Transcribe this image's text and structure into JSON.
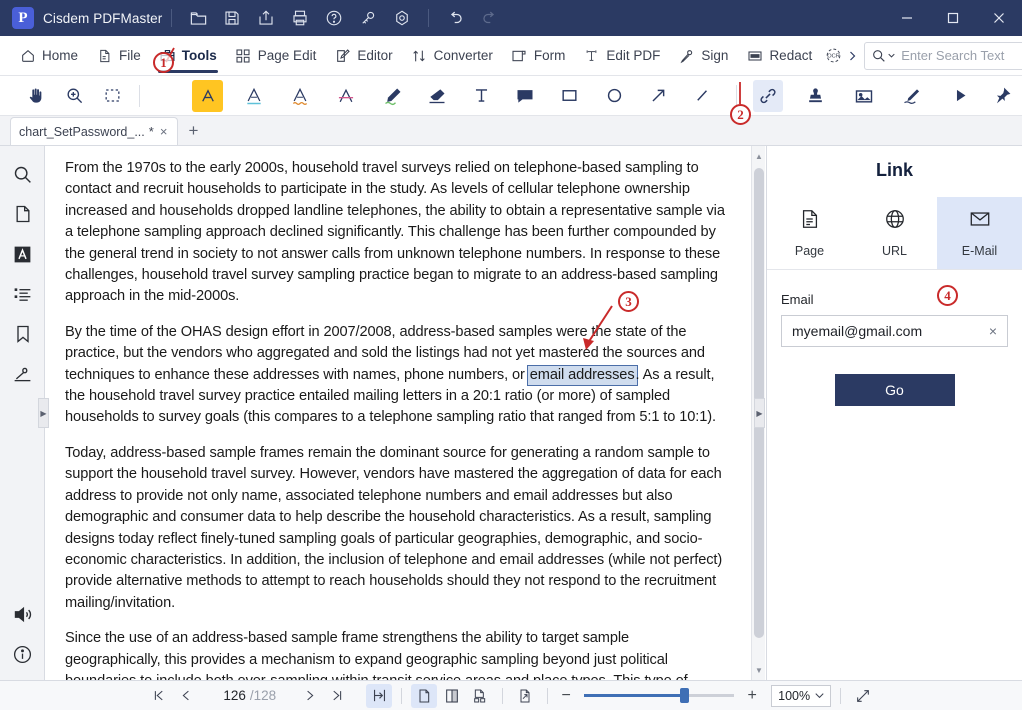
{
  "window": {
    "app_title": "Cisdem PDFMaster",
    "logo_letter": "P",
    "title_icons": [
      "open-folder-icon",
      "save-icon",
      "share-icon",
      "print-icon",
      "help-icon",
      "key-icon",
      "settings-icon",
      "undo-icon",
      "redo-icon"
    ],
    "controls": [
      "minimize",
      "maximize",
      "close"
    ]
  },
  "menubar": {
    "items": [
      {
        "label": "Home",
        "icon": "home-icon",
        "active": false
      },
      {
        "label": "File",
        "icon": "file-icon",
        "active": false
      },
      {
        "label": "Tools",
        "icon": "toolbox-icon",
        "active": true
      },
      {
        "label": "Page Edit",
        "icon": "grid-icon",
        "active": false
      },
      {
        "label": "Editor",
        "icon": "pencil-square-icon",
        "active": false
      },
      {
        "label": "Converter",
        "icon": "arrows-updown-icon",
        "active": false
      },
      {
        "label": "Form",
        "icon": "form-icon",
        "active": false
      },
      {
        "label": "Edit PDF",
        "icon": "text-cursor-icon",
        "active": false
      },
      {
        "label": "Sign",
        "icon": "signature-pen-icon",
        "active": false
      },
      {
        "label": "Redact",
        "icon": "redact-icon",
        "active": false
      }
    ],
    "ocr_label": "OCR",
    "overflow": "chevron-right-icon"
  },
  "search": {
    "placeholder": "Enter Search Text",
    "value": "",
    "icon": "search-dropdown-icon"
  },
  "toolstrip": {
    "tools": [
      {
        "name": "hand-tool",
        "state": "normal"
      },
      {
        "name": "zoom-tool",
        "state": "normal"
      },
      {
        "name": "select-area-tool",
        "state": "normal"
      },
      {
        "name": "highlight-text-tool",
        "state": "selected"
      },
      {
        "name": "underline-text-tool",
        "state": "normal"
      },
      {
        "name": "squiggly-underline-tool",
        "state": "normal"
      },
      {
        "name": "strikethrough-text-tool",
        "state": "normal"
      },
      {
        "name": "pencil-tool",
        "state": "normal"
      },
      {
        "name": "eraser-tool",
        "state": "normal"
      },
      {
        "name": "text-box-tool",
        "state": "normal"
      },
      {
        "name": "note-comment-tool",
        "state": "normal"
      },
      {
        "name": "rectangle-tool",
        "state": "normal"
      },
      {
        "name": "ellipse-tool",
        "state": "normal"
      },
      {
        "name": "arrow-tool",
        "state": "normal"
      },
      {
        "name": "line-tool",
        "state": "normal"
      },
      {
        "name": "link-tool",
        "state": "active"
      },
      {
        "name": "stamp-tool",
        "state": "normal"
      },
      {
        "name": "image-tool",
        "state": "normal"
      },
      {
        "name": "signature-tool",
        "state": "normal"
      },
      {
        "name": "play-media-tool",
        "state": "normal"
      },
      {
        "name": "pin-tool",
        "state": "normal"
      }
    ]
  },
  "tabs": {
    "documents": [
      {
        "label": "chart_SetPassword_...",
        "dirty": "*",
        "close": "×"
      }
    ],
    "add_label": "+"
  },
  "leftrail": {
    "items": [
      {
        "name": "search-panel-icon",
        "active": false
      },
      {
        "name": "thumbnails-panel-icon",
        "active": false
      },
      {
        "name": "text-panel-icon",
        "active": true
      },
      {
        "name": "outline-panel-icon",
        "active": false
      },
      {
        "name": "bookmark-panel-icon",
        "active": false
      },
      {
        "name": "signature-panel-icon",
        "active": false
      }
    ],
    "bottom": [
      {
        "name": "read-aloud-icon"
      },
      {
        "name": "info-icon"
      }
    ]
  },
  "document": {
    "paragraphs": [
      "From the 1970s to the early 2000s, household travel surveys relied on telephone-based sampling to contact and recruit households to participate in the study. As levels of cellular telephone ownership increased and households dropped landline telephones, the ability to obtain a representative sample via a telephone sampling approach declined significantly. This challenge has been further compounded by the general trend in society to not answer calls from unknown telephone numbers. In response to these challenges, household travel survey sampling practice began to migrate to an address-based sampling approach in the mid-2000s.",
      "Today, address-based sample frames remain the dominant source for generating a random sample to support the household travel survey. However, vendors have mastered the aggregation of data for each address to provide not only name, associated telephone numbers and email addresses but also demographic and consumer data to help describe the household characteristics. As a result, sampling designs today reflect finely-tuned sampling goals of particular geographies, demographic, and socio-economic characteristics. In addition, the inclusion of telephone and email addresses (while not perfect) provide alternative methods to attempt to reach households should they not respond to the recruitment mailing/invitation.",
      "Since the use of an address-based sample frame strengthens the ability to target sample geographically, this provides a mechanism to expand geographic sampling beyond just political boundaries to include both over-sampling within transit service areas and place types. This type of geographic targeted sampling has also been used to identify areas like off-campus student housing, off-"
    ],
    "link_paragraph": {
      "before": "By the time of the OHAS design effort in 2007/2008, address-based samples were the state of the practice, but the vendors who aggregated and sold the listings had not yet mastered the sources and techniques to enhance these addresses with names, phone numbers, or ",
      "selected": "email addresses",
      "after": ". As a result, the household travel survey practice entailed mailing letters in a 20:1 ratio (or more) of sampled households to survey goals (this compares to a telephone sampling ratio that ranged from 5:1 to 10:1)."
    }
  },
  "rightpanel": {
    "title": "Link",
    "types": [
      {
        "label": "Page",
        "icon": "page-document-icon",
        "active": false
      },
      {
        "label": "URL",
        "icon": "globe-icon",
        "active": false
      },
      {
        "label": "E-Mail",
        "icon": "envelope-icon",
        "active": true
      }
    ],
    "field_label": "Email",
    "email_value": "myemail@gmail.com",
    "email_placeholder": "",
    "clear_icon": "×",
    "go_label": "Go"
  },
  "statusbar": {
    "first_page": "first-page-icon",
    "prev_page": "prev-page-icon",
    "current_page": "126",
    "total_pages": "/128",
    "next_page": "next-page-icon",
    "last_page": "last-page-icon",
    "view_modes": [
      {
        "name": "fit-page-icon",
        "active": true
      },
      {
        "name": "single-page-icon",
        "active": true
      },
      {
        "name": "two-page-icon",
        "active": false
      },
      {
        "name": "continuous-scroll-icon",
        "active": false
      },
      {
        "name": "rotate-view-icon",
        "active": false
      }
    ],
    "zoom_out": "−",
    "zoom_in": "+",
    "zoom_value": "100%",
    "zoom_chevron": "chevron-down-icon",
    "fullscreen": "fullscreen-icon"
  },
  "annotations": {
    "markers": [
      {
        "label": "①",
        "text": "1"
      },
      {
        "label": "②",
        "text": "2"
      },
      {
        "label": "③",
        "text": "3"
      },
      {
        "label": "④",
        "text": "4"
      }
    ],
    "color": "#c92a2a"
  },
  "colors": {
    "titlebar": "#2b3a63",
    "accent": "#2b3a63",
    "highlight_yellow": "#ffc522",
    "selection_blue": "#cfdcee",
    "panel_active": "#dde6f8",
    "annotation_red": "#c92a2a"
  }
}
